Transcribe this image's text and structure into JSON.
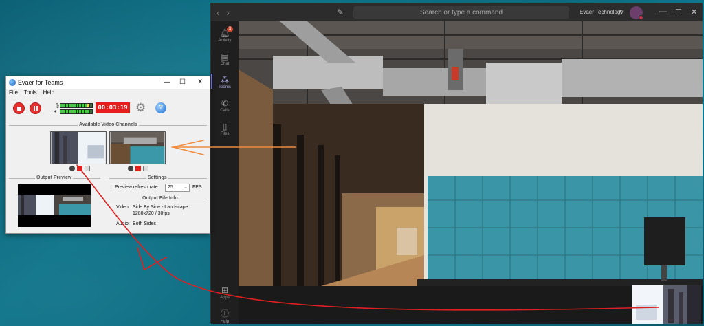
{
  "teams": {
    "search_placeholder": "Search or type a command",
    "org_name": "Evaer Technology",
    "rail": [
      {
        "label": "Activity",
        "icon": "bell-icon",
        "badge": "3"
      },
      {
        "label": "Chat",
        "icon": "chat-icon"
      },
      {
        "label": "Teams",
        "icon": "teams-icon"
      },
      {
        "label": "Calls",
        "icon": "phone-icon"
      },
      {
        "label": "Files",
        "icon": "file-icon"
      },
      {
        "label": "Apps",
        "icon": "apps-icon"
      },
      {
        "label": "Help",
        "icon": "help-icon"
      }
    ]
  },
  "evaer": {
    "title": "Evaer for Teams",
    "menu": [
      "File",
      "Tools",
      "Help"
    ],
    "timer": "00:03:19",
    "sections": {
      "channels": "Available Video Channels",
      "preview": "Output Preview",
      "settings": "Settings",
      "file_info": "Output File Info"
    },
    "refresh_label": "Preview refresh rate",
    "refresh_value": "25",
    "fps_label": "FPS",
    "video_label": "Video:",
    "video_mode": "Side By Side - Landscape",
    "video_res": "1280x720 / 30fps",
    "audio_label": "Audio:",
    "audio_value": "Both Sides"
  },
  "colors": {
    "record_red": "#e61e1e",
    "annotation_orange": "#f08a3c",
    "annotation_red": "#e01f1f",
    "teams_accent": "#7b83eb"
  }
}
